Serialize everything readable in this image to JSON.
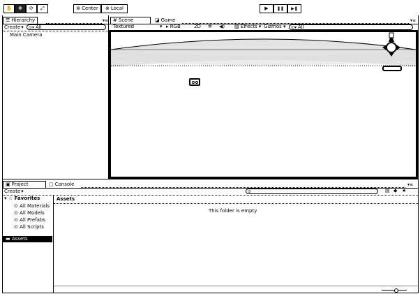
{
  "toolbar": {
    "tools": [
      {
        "icon": "hand-icon",
        "glyph": "✋"
      },
      {
        "icon": "move-icon",
        "glyph": "✥"
      },
      {
        "icon": "rotate-icon",
        "glyph": "⟳"
      },
      {
        "icon": "scale-icon",
        "glyph": "⤢"
      }
    ],
    "pivot_label": "Center",
    "space_label": "Local",
    "play_glyph": "▶",
    "pause_glyph": "❚❚",
    "step_glyph": "▶❚"
  },
  "hierarchy": {
    "tab_label": "Hierarchy",
    "create_label": "Create",
    "search_placeholder": "All",
    "items": [
      "Main Camera"
    ]
  },
  "scene": {
    "tab_label": "Scene",
    "game_tab_label": "Game",
    "shading_label": "Textured",
    "render_mode_label": "RGB",
    "toggle_2d_label": "2D",
    "effects_label": "Effects",
    "gizmos_label": "Gizmos",
    "search_placeholder": "All"
  },
  "project": {
    "tab_label": "Project",
    "console_tab_label": "Console",
    "create_label": "Create",
    "favorites_label": "Favorites",
    "favorites": [
      "All Materials",
      "All Models",
      "All Prefabs",
      "All Scripts"
    ],
    "assets_header": "Assets",
    "empty_message": "This folder is empty",
    "root_folder": "Assets"
  }
}
